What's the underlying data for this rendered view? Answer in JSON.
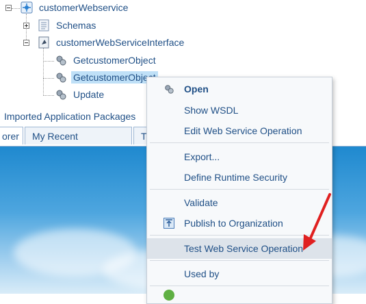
{
  "tree": {
    "root": "customerWebservice",
    "schemas": "Schemas",
    "interface": "customerWebServiceInterface",
    "ops": [
      "GetcustomerObject",
      "GetcustomerObject",
      "Update"
    ]
  },
  "packages_label": "Imported Application Packages",
  "tabs": [
    "orer",
    "My Recent Documents",
    "T"
  ],
  "menu": {
    "open": "Open",
    "show_wsdl": "Show WSDL",
    "edit": "Edit Web Service Operation",
    "export": "Export...",
    "define_security": "Define Runtime Security",
    "validate": "Validate",
    "publish": "Publish to Organization",
    "test": "Test Web Service Operation",
    "used_by": "Used by"
  },
  "colors": {
    "annotation_arrow": "#e02020",
    "selection": "#bfe0f7",
    "link_text": "#1f4f86"
  }
}
